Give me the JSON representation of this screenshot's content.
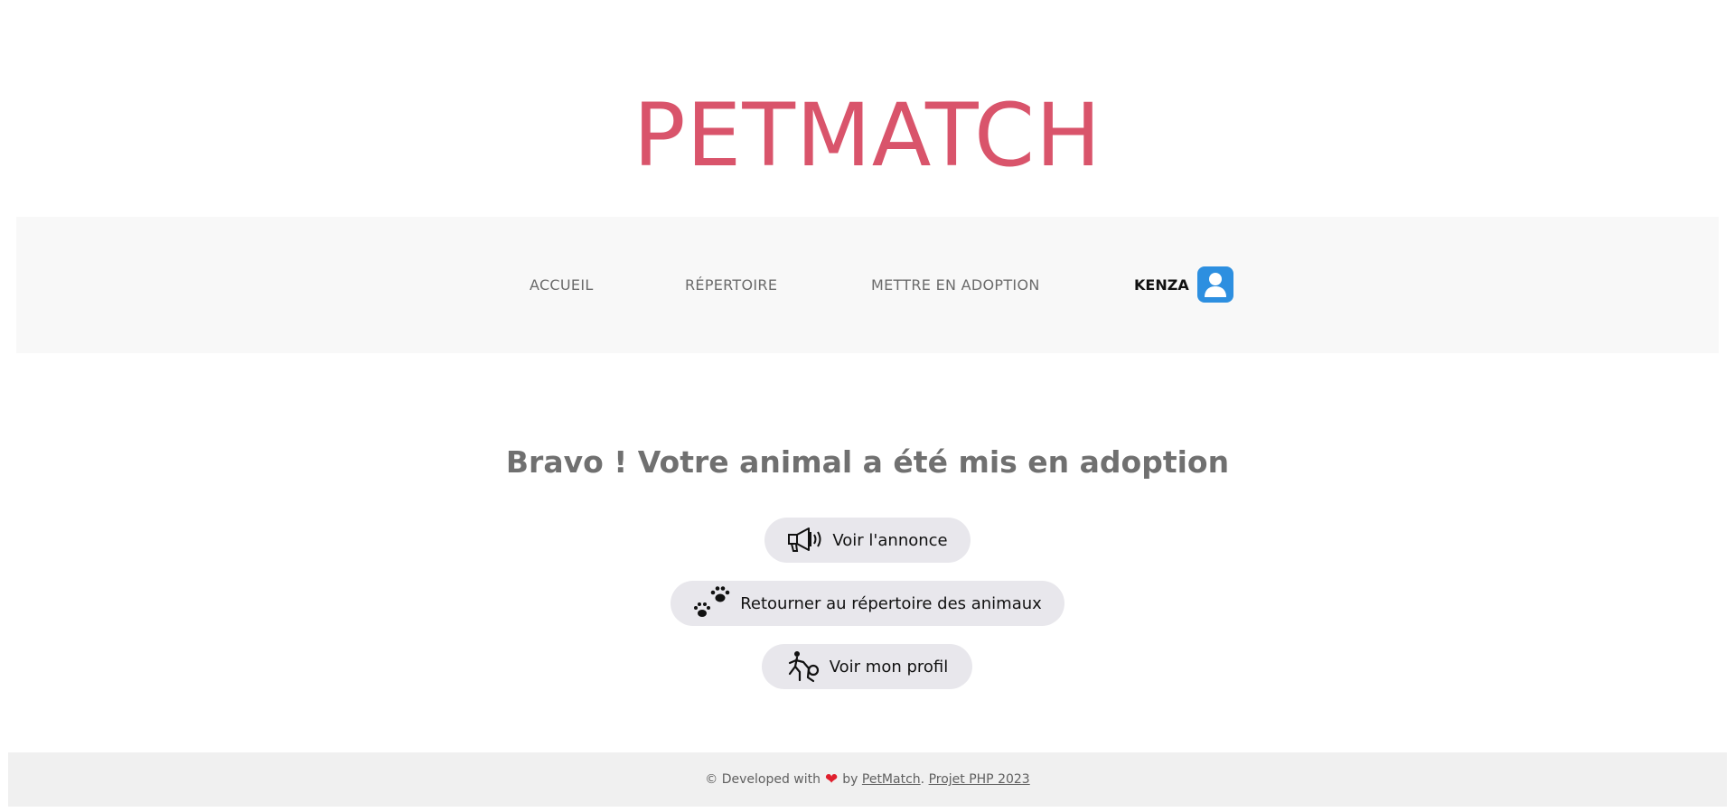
{
  "header": {
    "brand": "PETMATCH"
  },
  "nav": {
    "items": [
      {
        "label": "ACCUEIL"
      },
      {
        "label": "RÉPERTOIRE"
      },
      {
        "label": "METTRE EN ADOPTION"
      }
    ],
    "user": {
      "name": "KENZA",
      "icon": "user-avatar-icon",
      "avatar_color": "#2d8fe0"
    }
  },
  "main": {
    "title": "Bravo ! Votre animal a été mis en adoption",
    "buttons": [
      {
        "label": "Voir l'annonce",
        "icon": "megaphone-icon"
      },
      {
        "label": "Retourner au répertoire des animaux",
        "icon": "paw-prints-icon"
      },
      {
        "label": "Voir mon profil",
        "icon": "person-walking-dog-icon"
      }
    ]
  },
  "footer": {
    "prefix": "© Developed with",
    "heart_icon": "heart-icon",
    "by": "by",
    "link1": "PetMatch",
    "separator": ".",
    "link2": "Projet PHP 2023"
  },
  "colors": {
    "brand": "#d9546b",
    "nav_background": "#f8f8f8",
    "button_background": "#e8e7ec",
    "footer_background": "#f0f0f0",
    "heart": "#e0202e"
  }
}
